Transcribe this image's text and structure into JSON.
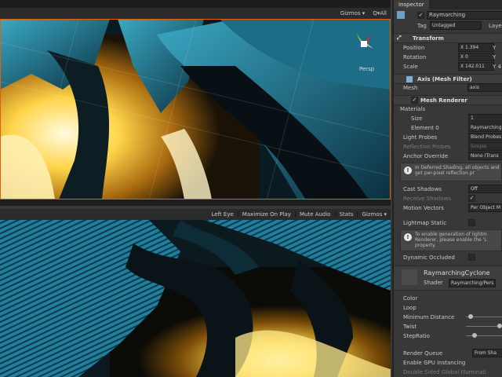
{
  "scene_bar": {
    "gizmos": "Gizmos ▾",
    "search": "Q▾All"
  },
  "scene_overlay": {
    "persp": "Persp"
  },
  "game_bar": [
    "Left Eye",
    "Maximize On Play",
    "Mute Audio",
    "Stats",
    "Gizmos ▾"
  ],
  "inspector": {
    "tab": "Inspector",
    "object_name": "Raymarching",
    "tag_label": "Tag",
    "tag_value": "Untagged",
    "layer_label": "Layer",
    "transform": {
      "title": "Transform",
      "position_label": "Position",
      "position_x": "X 1.394",
      "rotation_label": "Rotation",
      "rotation_x": "X 0",
      "scale_label": "Scale",
      "scale_x": "X 142.011",
      "y_label": "Y",
      "y_scale": "Y 4"
    },
    "mesh_filter": {
      "title": "Axis (Mesh Filter)",
      "mesh_label": "Mesh",
      "mesh_value": "axis"
    },
    "mesh_renderer": {
      "title": "Mesh Renderer",
      "materials": "Materials",
      "size_label": "Size",
      "size_value": "1",
      "element_label": "Element 0",
      "element_value": "Raymarching",
      "light_probes_label": "Light Probes",
      "light_probes_value": "Blend Probes",
      "reflection_probes_label": "Reflection Probes",
      "reflection_probes_value": "Simple",
      "anchor_label": "Anchor Override",
      "anchor_value": "None (Trans",
      "info1": "In Deferred Shading, all objects and get per-pixel reflection pr",
      "cast_label": "Cast Shadows",
      "cast_value": "Off",
      "receive_label": "Receive Shadows",
      "motion_label": "Motion Vectors",
      "motion_value": "Per Object M",
      "lightmap_label": "Lightmap Static",
      "info2": "To enable generation of lightm Renderer, please enable the 'L property.",
      "occluded_label": "Dynamic Occluded"
    },
    "material": {
      "name": "RaymarchingCyclone",
      "shader_label": "Shader",
      "shader_value": "Raymarching/Pers",
      "props": [
        "Color",
        "Loop",
        "Minimum Distance",
        "Twist",
        "StepRatio"
      ],
      "render_queue_label": "Render Queue",
      "render_queue_value": "From Sha",
      "gpu_label": "Enable GPU Instancing",
      "double_label": "Double Sided Global Illuminati"
    }
  }
}
